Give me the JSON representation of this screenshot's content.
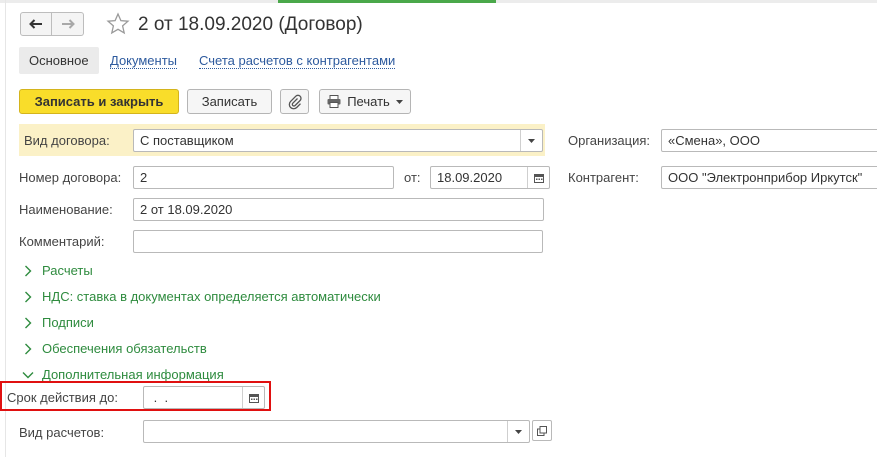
{
  "window": {
    "title": "2 от 18.09.2020 (Договор)"
  },
  "tabs": [
    {
      "label": "Основное",
      "active": true
    },
    {
      "label": "Документы"
    },
    {
      "label": "Счета расчетов с контрагентами"
    }
  ],
  "toolbar": {
    "save_close": "Записать и закрыть",
    "save": "Записать",
    "print": "Печать"
  },
  "form": {
    "contract_type": {
      "label": "Вид договора:",
      "value": "С поставщиком"
    },
    "organization": {
      "label": "Организация:",
      "value": "«Смена», ООО"
    },
    "contract_number": {
      "label": "Номер договора:",
      "value": "2"
    },
    "date": {
      "label": "от:",
      "value": "18.09.2020"
    },
    "counterparty": {
      "label": "Контрагент:",
      "value": "ООО \"Электронприбор Иркутск\""
    },
    "name": {
      "label": "Наименование:",
      "value": "2 от 18.09.2020"
    },
    "comment": {
      "label": "Комментарий:",
      "value": ""
    },
    "valid_until": {
      "label": "Срок действия до:",
      "value": " .  ."
    },
    "settlement_type": {
      "label": "Вид расчетов:",
      "value": ""
    }
  },
  "groups": [
    {
      "label": "Расчеты",
      "expanded": false
    },
    {
      "label": "НДС: ставка в документах определяется автоматически",
      "expanded": false
    },
    {
      "label": "Подписи",
      "expanded": false
    },
    {
      "label": "Обеспечения обязательств",
      "expanded": false
    },
    {
      "label": "Дополнительная информация",
      "expanded": true
    }
  ],
  "icons": {
    "back": "arrow-left-icon",
    "forward": "arrow-right-icon",
    "favorite": "star-icon",
    "attach": "paperclip-icon",
    "print": "printer-icon",
    "dropdown": "triangle-down-icon",
    "calendar": "calendar-icon",
    "open": "open-form-icon"
  },
  "colors": {
    "primary_button": "#f9dd2a",
    "highlight_row": "#fbf1c7",
    "group_text": "#2e8b3e",
    "link": "#2d5a9e",
    "focus_box": "#e01010"
  }
}
